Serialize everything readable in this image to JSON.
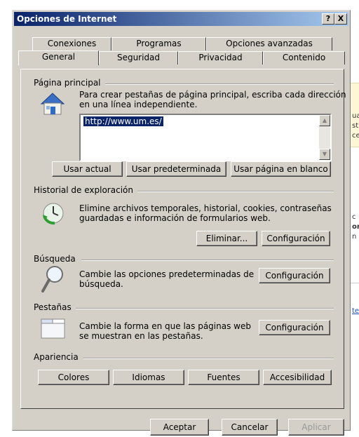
{
  "window": {
    "title": "Opciones de Internet",
    "help_label": "?",
    "close_label": "X"
  },
  "tabs_row1": [
    "Conexiones",
    "Programas",
    "Opciones avanzadas"
  ],
  "tabs_row2": [
    "General",
    "Seguridad",
    "Privacidad",
    "Contenido"
  ],
  "home": {
    "label": "Página principal",
    "desc1": "Para crear pestañas de página principal, escriba cada dirección",
    "desc2": "en una línea independiente.",
    "url": "http://www.um.es/",
    "btn_current": "Usar actual",
    "btn_default": "Usar predeterminada",
    "btn_blank": "Usar página en blanco"
  },
  "history": {
    "label": "Historial de exploración",
    "desc1": "Elimine archivos temporales, historial, cookies, contraseñas",
    "desc2": "guardadas e información de formularios web.",
    "btn_delete": "Eliminar...",
    "btn_config": "Configuración"
  },
  "search": {
    "label": "Búsqueda",
    "desc1": "Cambie las opciones predeterminadas de",
    "desc2": "búsqueda.",
    "btn_config": "Configuración"
  },
  "tabs_section": {
    "label": "Pestañas",
    "desc1": "Cambie la forma en que las páginas web",
    "desc2": "se muestran en las pestañas.",
    "btn_config": "Configuración"
  },
  "appearance": {
    "label": "Apariencia",
    "btn_colors": "Colores",
    "btn_languages": "Idiomas",
    "btn_fonts": "Fuentes",
    "btn_accessibility": "Accesibilidad"
  },
  "footer": {
    "ok": "Aceptar",
    "cancel": "Cancelar",
    "apply": "Aplicar"
  },
  "background_fragments": [
    "ua",
    "st",
    "ce",
    "c",
    "or",
    "n",
    "te"
  ]
}
